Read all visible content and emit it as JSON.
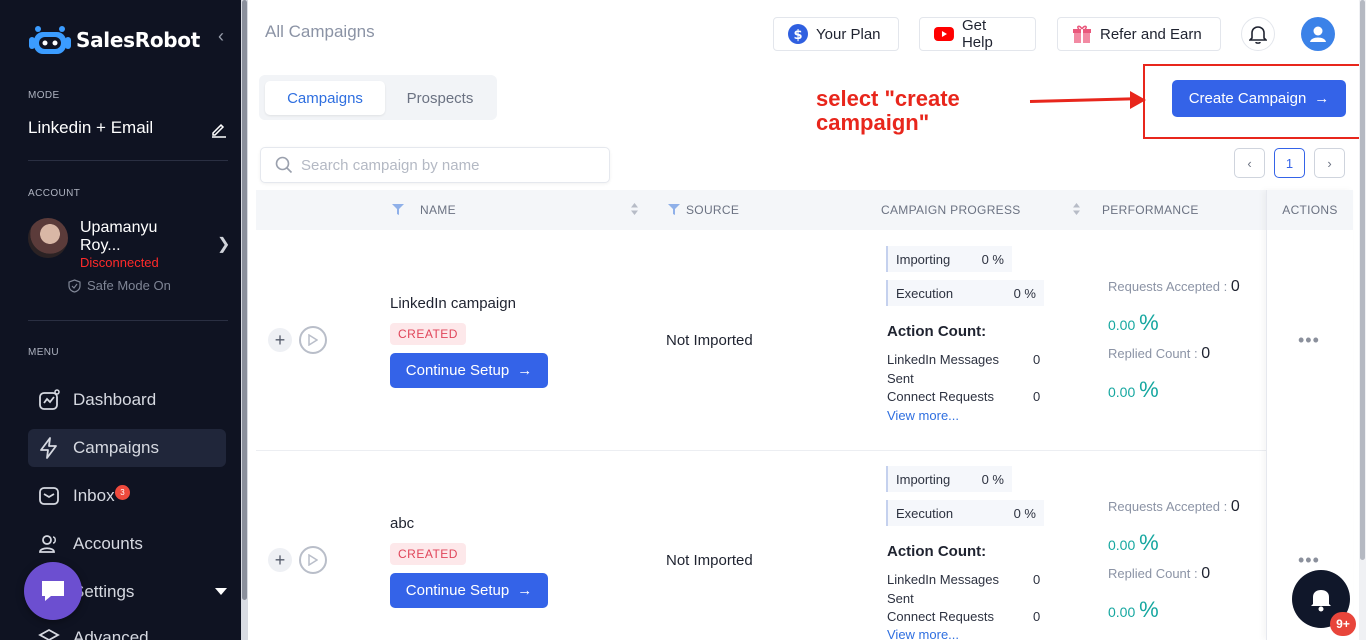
{
  "brand": {
    "name": "SalesRobot"
  },
  "sidebar": {
    "mode_label": "MODE",
    "mode_value": "Linkedin + Email",
    "account_label": "ACCOUNT",
    "account_name": "Upamanyu Roy...",
    "account_status": "Disconnected",
    "safe_mode": "Safe Mode On",
    "menu_label": "MENU",
    "items": [
      {
        "label": "Dashboard",
        "icon": "dashboard-icon"
      },
      {
        "label": "Campaigns",
        "icon": "lightning-icon",
        "active": true
      },
      {
        "label": "Inbox",
        "icon": "mail-icon",
        "badge": "3"
      },
      {
        "label": "Accounts",
        "icon": "users-icon"
      },
      {
        "label": "Settings",
        "icon": "gear-icon"
      },
      {
        "label": "Advanced",
        "icon": "layers-icon"
      }
    ]
  },
  "header": {
    "title": "All Campaigns",
    "your_plan": "Your Plan",
    "get_help": "Get Help",
    "refer_earn": "Refer and Earn"
  },
  "tabs": {
    "campaigns": "Campaigns",
    "prospects": "Prospects"
  },
  "annotation": {
    "text_line1": "select \"create",
    "text_line2": "campaign\""
  },
  "create_button": {
    "label": "Create Campaign"
  },
  "search": {
    "placeholder": "Search campaign by name",
    "value": ""
  },
  "pagination": {
    "current": "1"
  },
  "table": {
    "columns": [
      "NAME",
      "SOURCE",
      "CAMPAIGN PROGRESS",
      "PERFORMANCE",
      "ACTIONS"
    ],
    "rows": [
      {
        "name": "LinkedIn campaign",
        "status": "CREATED",
        "button": "Continue Setup",
        "source": "Not Imported",
        "importing_label": "Importing",
        "importing_value": "0 %",
        "execution_label": "Execution",
        "execution_value": "0 %",
        "action_count_title": "Action Count:",
        "linkedin_messages_label": "LinkedIn Messages Sent",
        "linkedin_messages_value": "0",
        "connect_requests_label": "Connect Requests",
        "connect_requests_value": "0",
        "view_more": "View more...",
        "requests_accepted_label": "Requests Accepted : ",
        "requests_accepted_value": "0",
        "requests_accepted_pct": "0.00",
        "replied_label": "Replied Count : ",
        "replied_value": "0",
        "replied_pct": "0.00"
      },
      {
        "name": "abc",
        "status": "CREATED",
        "button": "Continue Setup",
        "source": "Not Imported",
        "importing_label": "Importing",
        "importing_value": "0 %",
        "execution_label": "Execution",
        "execution_value": "0 %",
        "action_count_title": "Action Count:",
        "linkedin_messages_label": "LinkedIn Messages Sent",
        "linkedin_messages_value": "0",
        "connect_requests_label": "Connect Requests",
        "connect_requests_value": "0",
        "view_more": "View more...",
        "requests_accepted_label": "Requests Accepted : ",
        "requests_accepted_value": "0",
        "requests_accepted_pct": "0.00",
        "replied_label": "Replied Count : ",
        "replied_value": "0",
        "replied_pct": "0.00"
      }
    ]
  },
  "pct_symbol": "%",
  "notifications": {
    "count": "9+"
  },
  "colors": {
    "accent": "#3463e8",
    "sidebar_bg": "#0f1322",
    "danger": "#e8261c",
    "teal": "#16a7a0"
  }
}
